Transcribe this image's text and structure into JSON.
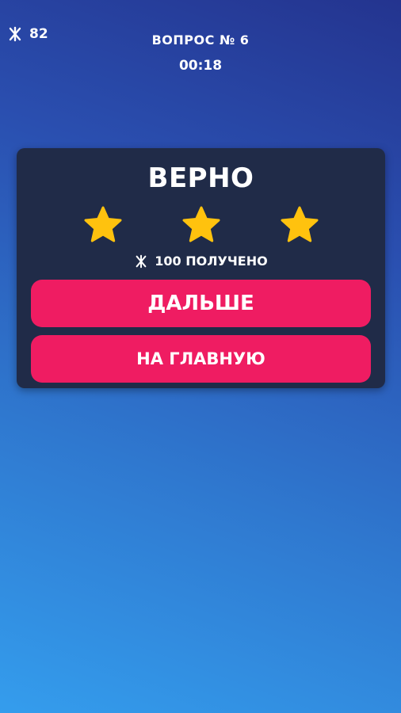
{
  "hud": {
    "coin_icon": "coin-symbol-icon",
    "coins": "82",
    "question_label": "ВОПРОС № 6",
    "timer": "00:18"
  },
  "result": {
    "title": "ВЕРНО",
    "stars_earned": 3,
    "stars_total": 3,
    "star_color": "#ffc20e",
    "reward_text": "100 ПОЛУЧЕНО"
  },
  "buttons": {
    "next_label": "ДАЛЬШЕ",
    "home_label": "НА ГЛАВНУЮ",
    "color": "#ef1c62"
  },
  "colors": {
    "card_background": "#202b48",
    "background_top": "#24348f",
    "background_bottom": "#349ded"
  }
}
